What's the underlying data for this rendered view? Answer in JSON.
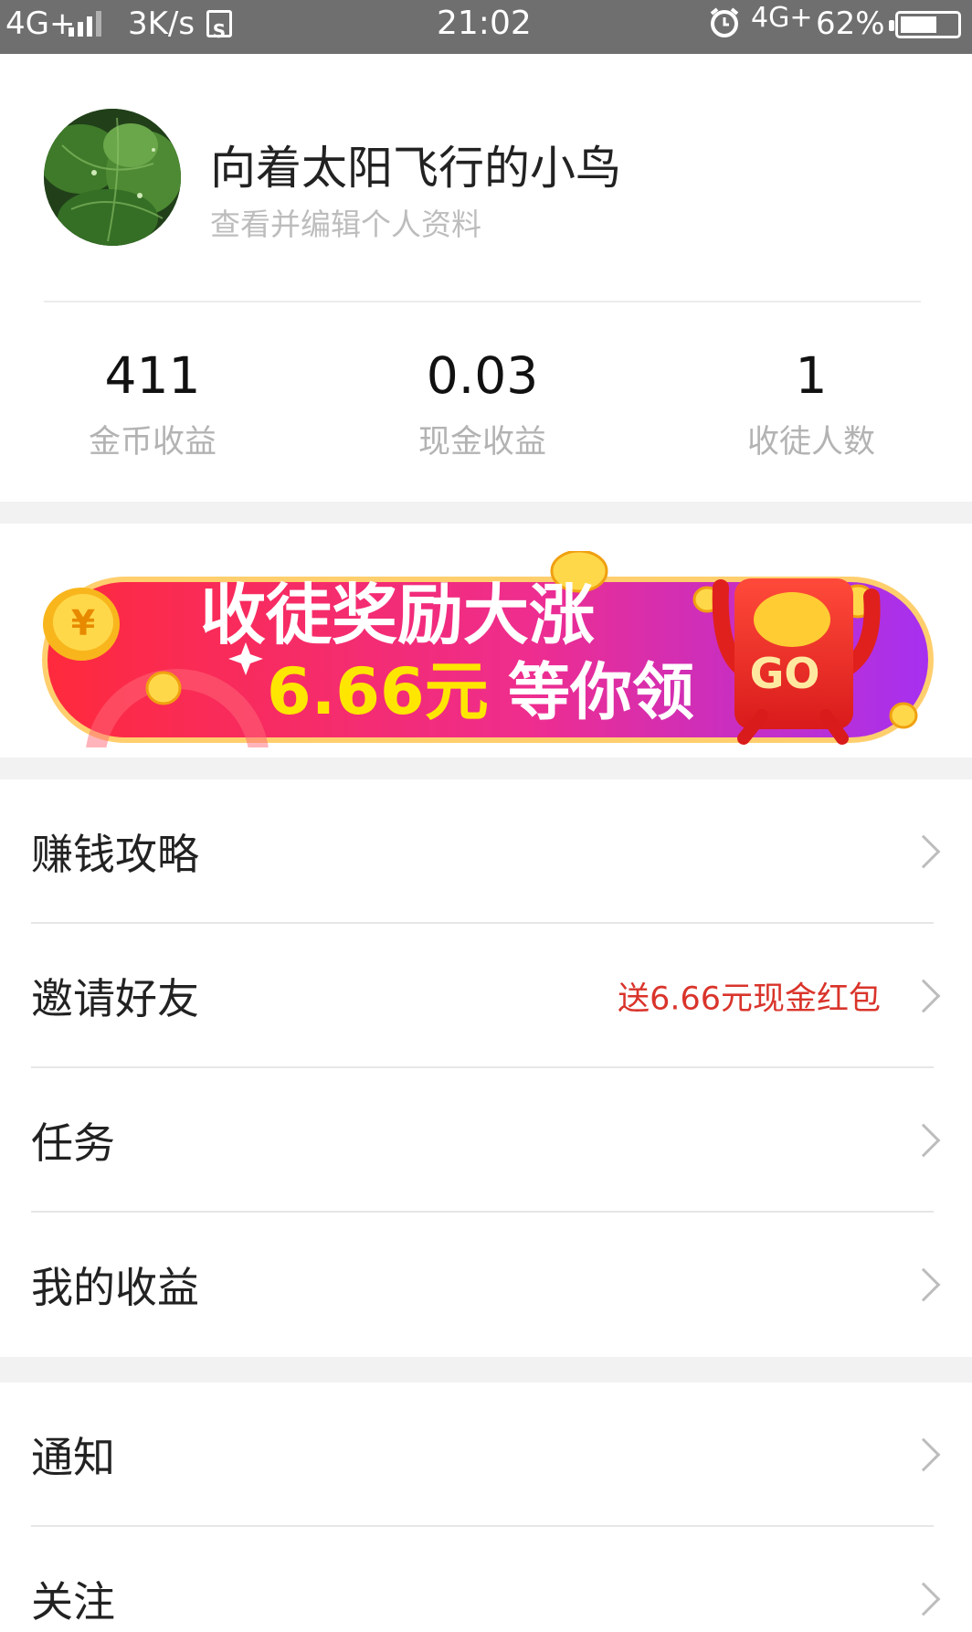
{
  "status_bar": {
    "network": "4G+",
    "speed": "3K/s",
    "sim_icon": "S",
    "time": "21:02",
    "network_right": "4G+",
    "battery": "62%"
  },
  "profile": {
    "username": "向着太阳飞行的小鸟",
    "edit_link": "查看并编辑个人资料"
  },
  "stats": [
    {
      "value": "411",
      "label": "金币收益"
    },
    {
      "value": "0.03",
      "label": "现金收益"
    },
    {
      "value": "1",
      "label": "收徒人数"
    }
  ],
  "banner": {
    "headline": "收徒奖励大涨",
    "amount": "6.66元",
    "tagline": "等你领",
    "go": "GO",
    "coin_symbol": "¥"
  },
  "menu": {
    "earn_guide": "赚钱攻略",
    "invite": "邀请好友",
    "invite_promo": "送6.66元现金红包",
    "tasks": "任务",
    "my_earnings": "我的收益",
    "notifications": "通知",
    "following": "关注"
  },
  "colors": {
    "status_bar_bg": "#6f6f6f",
    "promo_red": "#d9342b",
    "banner_gradient_start": "#ff2a3c",
    "banner_gradient_end": "#a630f0",
    "amount_yellow": "#ffe600"
  }
}
